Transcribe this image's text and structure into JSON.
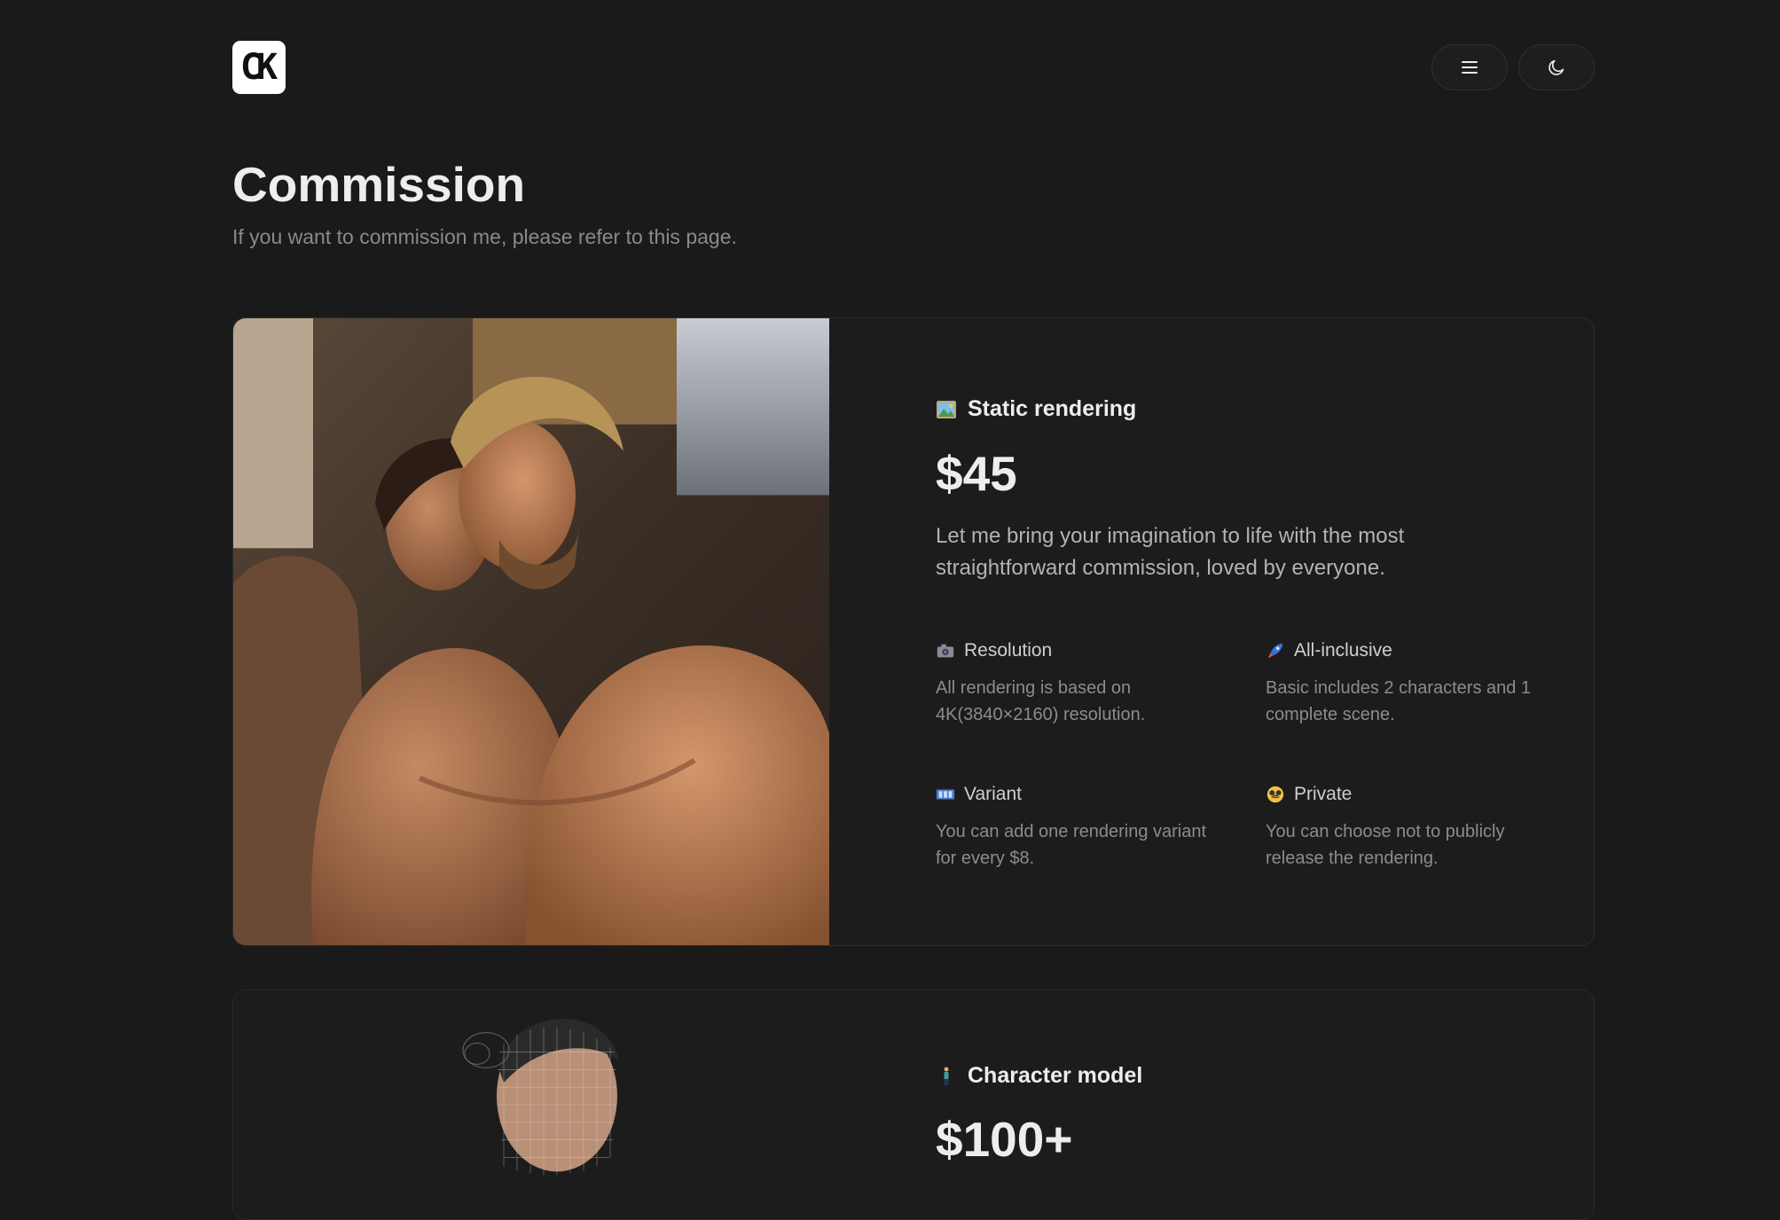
{
  "logo": {
    "text": "CK"
  },
  "header": {
    "menu_icon": "menu-icon",
    "theme_icon": "moon-icon"
  },
  "page": {
    "title": "Commission",
    "subtitle": "If you want to commission me, please refer to this page."
  },
  "cards": [
    {
      "title": "Static rendering",
      "icon": "framed-picture-icon",
      "price": "$45",
      "description": "Let me bring your imagination to life with the most straightforward commission, loved by everyone.",
      "features": [
        {
          "icon": "camera-icon",
          "title": "Resolution",
          "text": "All rendering is based on 4K(3840×2160) resolution."
        },
        {
          "icon": "rocket-icon",
          "title": "All-inclusive",
          "text": "Basic includes 2 characters and 1 complete scene."
        },
        {
          "icon": "film-frames-icon",
          "title": "Variant",
          "text": "You can add one rendering variant for every $8."
        },
        {
          "icon": "disguised-face-icon",
          "title": "Private",
          "text": "You can choose not to publicly release the rendering."
        }
      ]
    },
    {
      "title": "Character model",
      "icon": "person-standing-icon",
      "price": "$100+"
    }
  ],
  "colors": {
    "background": "#1a1a1a",
    "card": "#1c1c1c",
    "text": "#ededed",
    "muted": "#8a8a8a"
  }
}
